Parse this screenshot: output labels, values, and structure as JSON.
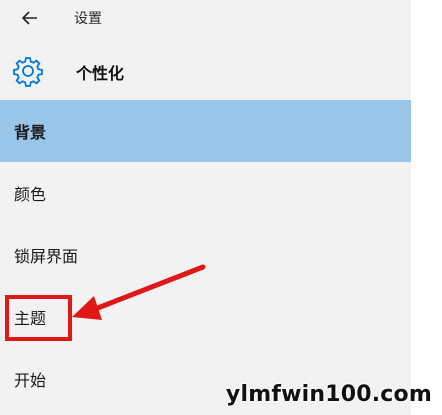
{
  "topbar": {
    "title": "设置",
    "back_icon": "arrow-left-icon"
  },
  "header": {
    "title": "个性化",
    "icon": "gear-icon"
  },
  "nav": {
    "items": [
      {
        "label": "背景",
        "active": true
      },
      {
        "label": "颜色",
        "active": false
      },
      {
        "label": "锁屏界面",
        "active": false
      },
      {
        "label": "主题",
        "active": false,
        "highlighted": true
      },
      {
        "label": "开始",
        "active": false
      }
    ]
  },
  "annotation": {
    "highlight_color": "#e01717",
    "arrow_color": "#e01717"
  },
  "watermark": {
    "text": "ylmfwin100.com"
  },
  "colors": {
    "sidebar_bg": "#f2f2f2",
    "active_bg": "#99c5e9",
    "accent": "#0078d7"
  }
}
